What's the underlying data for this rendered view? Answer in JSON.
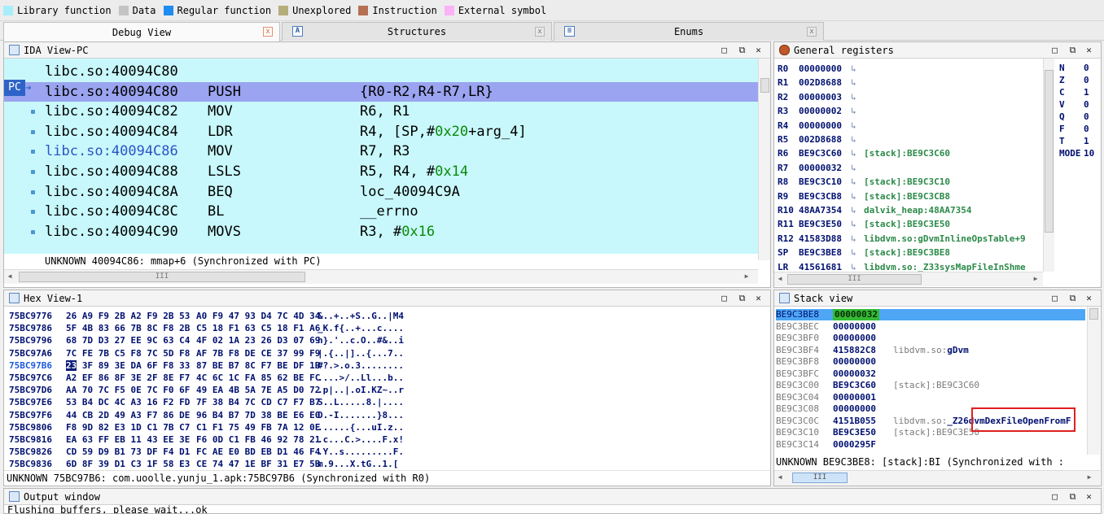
{
  "legend": [
    {
      "label": "Library function",
      "color": "#a6eefa"
    },
    {
      "label": "Data",
      "color": "#c4c4c4"
    },
    {
      "label": "Regular function",
      "color": "#1e8cf0"
    },
    {
      "label": "Unexplored",
      "color": "#b6ad7c"
    },
    {
      "label": "Instruction",
      "color": "#b57054"
    },
    {
      "label": "External symbol",
      "color": "#fbb2f6"
    }
  ],
  "tabs": [
    {
      "label": "Debug View",
      "close": "x",
      "active": true
    },
    {
      "label": "Structures",
      "close": "x",
      "icon": "A"
    },
    {
      "label": "Enums",
      "close": "x",
      "icon": "≡"
    }
  ],
  "ida": {
    "title": "IDA View-PC",
    "pc_label": "PC",
    "rows": [
      {
        "addr": "libc.so:40094C80",
        "mn": "",
        "op": ""
      },
      {
        "addr": "libc.so:40094C80",
        "mn": "PUSH",
        "op": "{R0-R2,R4-R7,LR}"
      },
      {
        "addr": "libc.so:40094C82",
        "mn": "MOV",
        "op": "R6, R1"
      },
      {
        "addr": "libc.so:40094C84",
        "mn": "LDR",
        "op_pre": "R4, [SP,#",
        "op_num": "0x20",
        "op_post": "+arg_4]"
      },
      {
        "addr": "libc.so:40094C86",
        "mn": "MOV",
        "op": "R7, R3"
      },
      {
        "addr": "libc.so:40094C88",
        "mn": "LSLS",
        "op_pre": "R5, R4, #",
        "op_num": "0x14",
        "op_post": ""
      },
      {
        "addr": "libc.so:40094C8A",
        "mn": "BEQ",
        "op": "loc_40094C9A"
      },
      {
        "addr": "libc.so:40094C8C",
        "mn": "BL",
        "op": "__errno"
      },
      {
        "addr": "libc.so:40094C90",
        "mn": "MOVS",
        "op_pre": "R3, #",
        "op_num": "0x16",
        "op_post": ""
      }
    ],
    "status": "UNKNOWN 40094C86: mmap+6 (Synchronized with PC)"
  },
  "registers": {
    "title": "General registers",
    "rows": [
      {
        "name": "R0",
        "value": "00000000",
        "ref": ""
      },
      {
        "name": "R1",
        "value": "002D8688",
        "ref": ""
      },
      {
        "name": "R2",
        "value": "00000003",
        "ref": ""
      },
      {
        "name": "R3",
        "value": "00000002",
        "ref": ""
      },
      {
        "name": "R4",
        "value": "00000000",
        "ref": ""
      },
      {
        "name": "R5",
        "value": "002D8688",
        "ref": ""
      },
      {
        "name": "R6",
        "value": "BE9C3C60",
        "ref": "[stack]:BE9C3C60"
      },
      {
        "name": "R7",
        "value": "00000032",
        "ref": ""
      },
      {
        "name": "R8",
        "value": "BE9C3C10",
        "ref": "[stack]:BE9C3C10"
      },
      {
        "name": "R9",
        "value": "BE9C3CB8",
        "ref": "[stack]:BE9C3CB8"
      },
      {
        "name": "R10",
        "value": "48AA7354",
        "ref": "dalvik_heap:48AA7354"
      },
      {
        "name": "R11",
        "value": "BE9C3E50",
        "ref": "[stack]:BE9C3E50"
      },
      {
        "name": "R12",
        "value": "41583D88",
        "ref": "libdvm.so:gDvmInlineOpsTable+9"
      },
      {
        "name": "SP",
        "value": "BE9C3BE8",
        "ref": "[stack]:BE9C3BE8"
      },
      {
        "name": "LR",
        "value": "41561681",
        "ref": "libdvm.so:_Z33sysMapFileInShme"
      }
    ],
    "flags": [
      {
        "name": "N",
        "value": "0"
      },
      {
        "name": "Z",
        "value": "0"
      },
      {
        "name": "C",
        "value": "1"
      },
      {
        "name": "V",
        "value": "0"
      },
      {
        "name": "Q",
        "value": "0"
      },
      {
        "name": "F",
        "value": "0"
      },
      {
        "name": "T",
        "value": "1"
      },
      {
        "name": "MODE",
        "value": "10"
      }
    ]
  },
  "hex": {
    "title": "Hex View-1",
    "rows": [
      {
        "addr": "75BC9776",
        "b1": "26 A9 F9 2B A2 F9 2B 53",
        "b2": "A0 F9 47 93 D4 7C 4D 34",
        "ascii": "&..+..+S..G..|M4"
      },
      {
        "addr": "75BC9786",
        "b1": "5F 4B 83 66 7B 8C F8 2B",
        "b2": "C5 18 F1 63 C5 18 F1 A6",
        "ascii": "_K.f{..+...c...."
      },
      {
        "addr": "75BC9796",
        "b1": "68 7D D3 27 EE 9C 63 C4",
        "b2": "4F 02 1A 23 26 D3 07 69",
        "ascii": "h}.'..c.O..#&..i"
      },
      {
        "addr": "75BC97A6",
        "b1": "7C FE 7B C5 F8 7C 5D F8",
        "b2": "AF 7B F8 DE CE 37 99 F9",
        "ascii": "|.{..|]..{...7.."
      },
      {
        "addr": "75BC97B6",
        "b1_sel": "23",
        "b1": " 3F 89 3E DA 6F F8 33",
        "b2": "87 BE B7 8C F7 BE DF 1B",
        "ascii": "#?.>.o.3........",
        "hl": true
      },
      {
        "addr": "75BC97C6",
        "b1": "A2 EF 86 8F 3E 2F 8E F7",
        "b2": "4C 6C 1C FA 85 62 BE FC",
        "ascii": "....>/..Ll...b.."
      },
      {
        "addr": "75BC97D6",
        "b1": "AA 70 7C F5 0E 7C F0 6F",
        "b2": "49 EA 4B 5A 7E A5 D0 72",
        "ascii": ".p|..|.oI.KZ~..r"
      },
      {
        "addr": "75BC97E6",
        "b1": "53 B4 DC 4C A3 16 F2 FD",
        "b2": "7F 38 B4 7C CD C7 F7 B7",
        "ascii": "S..L.....8.|...."
      },
      {
        "addr": "75BC97F6",
        "b1": "44 CB 2D 49 A3 F7 86 DE",
        "b2": "96 B4 B7 7D 38 BE E6 E0",
        "ascii": "D.-I.......}8..."
      },
      {
        "addr": "75BC9806",
        "b1": "F8 9D 82 E3 1D C1 7B C7",
        "b2": "C1 F1 75 49 FB 7A 12 0E",
        "ascii": "......{...uI.z.."
      },
      {
        "addr": "75BC9816",
        "b1": "EA 63 FF EB 11 43 EE 3E",
        "b2": "F6 0D C1 FB 46 92 78 21",
        "ascii": ".c...C.>....F.x!"
      },
      {
        "addr": "75BC9826",
        "b1": "CD 59 D9 B1 73 DF F4 D1",
        "b2": "FC AE E0 BD EB D1 46 F4",
        "ascii": ".Y..s.........F."
      },
      {
        "addr": "75BC9836",
        "b1": "6D 8F 39 D1 C3 1F 58 E3",
        "b2": "CE 74 47 1E BF 31 E7 5B",
        "ascii": "m.9...X.tG..1.["
      }
    ],
    "status": "UNKNOWN 75BC97B6: com.uoolle.yunju_1.apk:75BC97B6 (Synchronized with R0)"
  },
  "stack": {
    "title": "Stack view",
    "rows": [
      {
        "addr": "BE9C3BE8",
        "value": "00000032",
        "ann": "",
        "sel": true
      },
      {
        "addr": "BE9C3BEC",
        "value": "00000000",
        "ann": ""
      },
      {
        "addr": "BE9C3BF0",
        "value": "00000000",
        "ann": ""
      },
      {
        "addr": "BE9C3BF4",
        "value": "415882C8",
        "ann_pre": "libdvm.so:",
        "ann_bold": "gDvm"
      },
      {
        "addr": "BE9C3BF8",
        "value": "00000000",
        "ann": ""
      },
      {
        "addr": "BE9C3BFC",
        "value": "00000032",
        "ann": ""
      },
      {
        "addr": "BE9C3C00",
        "value": "BE9C3C60",
        "ann": "[stack]:BE9C3C60"
      },
      {
        "addr": "BE9C3C04",
        "value": "00000001",
        "ann": ""
      },
      {
        "addr": "BE9C3C08",
        "value": "00000000",
        "ann": ""
      },
      {
        "addr": "BE9C3C0C",
        "value": "4151B055",
        "ann_pre": "libdvm.so:",
        "ann_bold": "_Z26dvmDexFileOpenFromF"
      },
      {
        "addr": "BE9C3C10",
        "value": "BE9C3E50",
        "ann": "[stack]:BE9C3E50"
      },
      {
        "addr": "BE9C3C14",
        "value": "0000295F",
        "ann": ""
      }
    ],
    "status": "UNKNOWN BE9C3BE8: [stack]:BI (Synchronized with :"
  },
  "output": {
    "title": "Output window",
    "text": "Flushing buffers, please wait...ok"
  },
  "controls": {
    "restore": "□",
    "maximize": "⧉",
    "close": "✕"
  },
  "scroll_thumb_grip": "III"
}
